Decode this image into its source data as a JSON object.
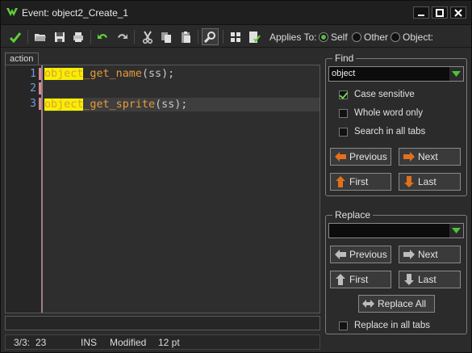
{
  "window": {
    "title": "Event: object2_Create_1"
  },
  "toolbar": {
    "applies_label": "Applies To:",
    "options": [
      {
        "label": "Self",
        "selected": true
      },
      {
        "label": "Other",
        "selected": false
      },
      {
        "label": "Object:",
        "selected": false
      }
    ]
  },
  "editor": {
    "tab_label": "action",
    "lines": [
      {
        "number": "1",
        "highlight": "object",
        "rest_fn": "_get_name",
        "rest_args": "(ss);",
        "current": false
      },
      {
        "number": "2",
        "highlight": "",
        "rest_fn": "",
        "rest_args": "",
        "current": false
      },
      {
        "number": "3",
        "highlight": "object",
        "rest_fn": "_get_sprite",
        "rest_args": "(ss);",
        "current": true
      }
    ],
    "find_value": ""
  },
  "status": {
    "position": "3/3:",
    "column": "23",
    "mode": "INS",
    "state": "Modified",
    "font_size": "12 pt"
  },
  "find": {
    "title": "Find",
    "value": "object",
    "case_sensitive": {
      "label": "Case sensitive",
      "checked": true
    },
    "whole_word": {
      "label": "Whole word only",
      "checked": false
    },
    "all_tabs": {
      "label": "Search in all tabs",
      "checked": false
    },
    "previous_label": "Previous",
    "next_label": "Next",
    "first_label": "First",
    "last_label": "Last"
  },
  "replace": {
    "title": "Replace",
    "value": "",
    "previous_label": "Previous",
    "next_label": "Next",
    "first_label": "First",
    "last_label": "Last",
    "replace_all_label": "Replace All",
    "all_tabs": {
      "label": "Replace in all tabs",
      "checked": false
    }
  },
  "colors": {
    "accent_green": "#4fc23a",
    "arrow_orange": "#e0701e",
    "highlight_yellow": "#f4f000",
    "code_orange": "#e89a3c",
    "line_number_blue": "#6f9fd8"
  }
}
